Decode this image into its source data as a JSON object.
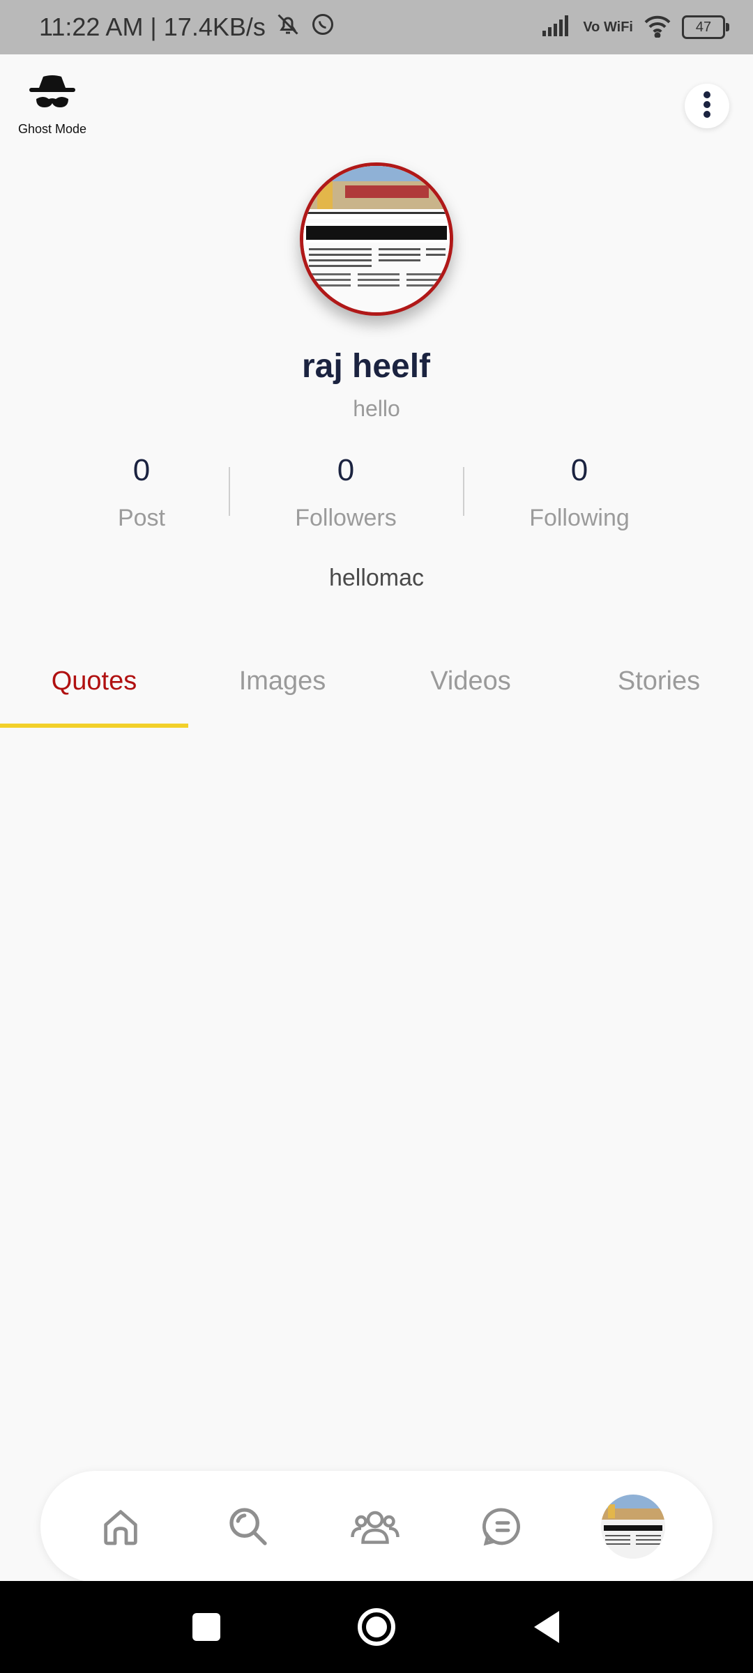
{
  "status_bar": {
    "time_speed": "11:22 AM | 17.4KB/s",
    "vowifi": "Vo WiFi",
    "battery": "47",
    "icons": [
      "bell-off-icon",
      "whatsapp-icon",
      "signal-icon",
      "wifi-icon",
      "battery-icon"
    ]
  },
  "header": {
    "ghost_mode_label": "Ghost Mode",
    "ghost_icon": "incognito-icon",
    "more_icon": "more-vertical-icon"
  },
  "profile": {
    "name": "raj heelf",
    "bio": "hello",
    "username": "hellomac",
    "stats": [
      {
        "value": "0",
        "label": "Post"
      },
      {
        "value": "0",
        "label": "Followers"
      },
      {
        "value": "0",
        "label": "Following"
      }
    ]
  },
  "tabs": {
    "items": [
      {
        "label": "Quotes"
      },
      {
        "label": "Images"
      },
      {
        "label": "Videos"
      },
      {
        "label": "Stories"
      }
    ],
    "active": "Quotes"
  },
  "bottom_nav": {
    "items": [
      "home-icon",
      "search-icon",
      "community-icon",
      "chat-icon",
      "profile-avatar"
    ]
  },
  "colors": {
    "accent": "#b01010",
    "indicator": "#f2d02a",
    "text_primary": "#1b2340",
    "text_muted": "#9a9a9a"
  }
}
